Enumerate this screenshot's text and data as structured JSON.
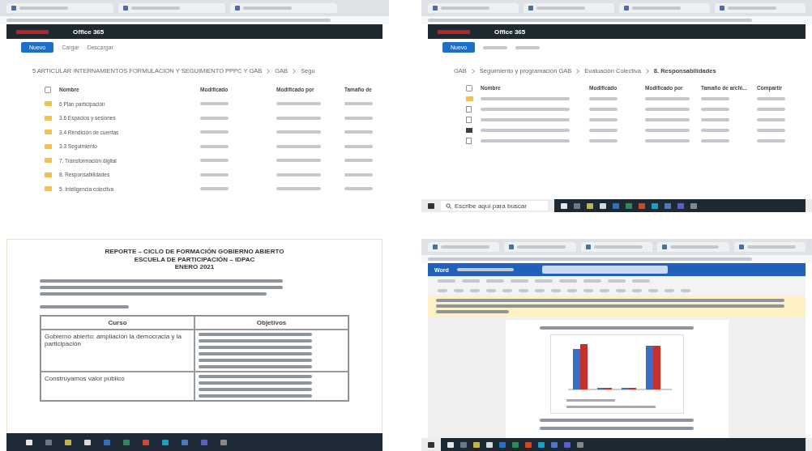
{
  "top_left_window": {
    "app_title": "Office 365",
    "toolbar": [
      "Nuevo",
      "Cargar",
      "Descargar"
    ],
    "breadcrumb": [
      "5 ARTICULAR INTERNAMIENTOS FORMULACION Y SEGUIMIENTO PPPC Y GAB",
      "GAB",
      "Segu"
    ],
    "select_all_checked": false,
    "columns": [
      "Nombre",
      "Modificado",
      "Modificado por",
      "Tamaño de"
    ],
    "rows": [
      {
        "name": "6 Plan participación"
      },
      {
        "name": "3.6 Espacios y sesiones"
      },
      {
        "name": "3.4 Rendición de cuentas"
      },
      {
        "name": "3.3 Seguimiento"
      },
      {
        "name": "7. Transformación digital"
      },
      {
        "name": "8. Responsabilidades"
      },
      {
        "name": "5. Inteligencia colectiva"
      }
    ]
  },
  "top_right_window": {
    "app_title": "Office 365",
    "toolbar": [
      "Nuevo"
    ],
    "breadcrumb": [
      "GAB",
      "Seguimiento y programación GAB",
      "Evaluación Colectiva",
      "8. Responsabilidades"
    ],
    "select_all_checked": false,
    "columns": [
      "Nombre",
      "Modificado",
      "Modificado por",
      "Tamaño de archi...",
      "Compartir"
    ],
    "rows": [
      {
        "kind": "folder"
      },
      {
        "kind": "file"
      },
      {
        "kind": "file"
      },
      {
        "kind": "image"
      },
      {
        "kind": "file"
      }
    ],
    "taskbar": {
      "search_placeholder": "Escribe aquí para buscar"
    }
  },
  "bottom_left_document": {
    "title_lines": [
      "REPORTE – CICLO DE FORMACIÓN GOBIERNO ABIERTO",
      "ESCUELA DE PARTICIPACIÓN – IDPAC",
      "ENERO 2021"
    ],
    "table": {
      "columns": [
        "Curso",
        "Objetivos"
      ],
      "rows": [
        {
          "course": "Gobierno abierto: ampliación la democracia y la participación"
        },
        {
          "course": "Construyamos valor público"
        }
      ]
    }
  },
  "bottom_right_word": {
    "app_name": "Word"
  }
}
